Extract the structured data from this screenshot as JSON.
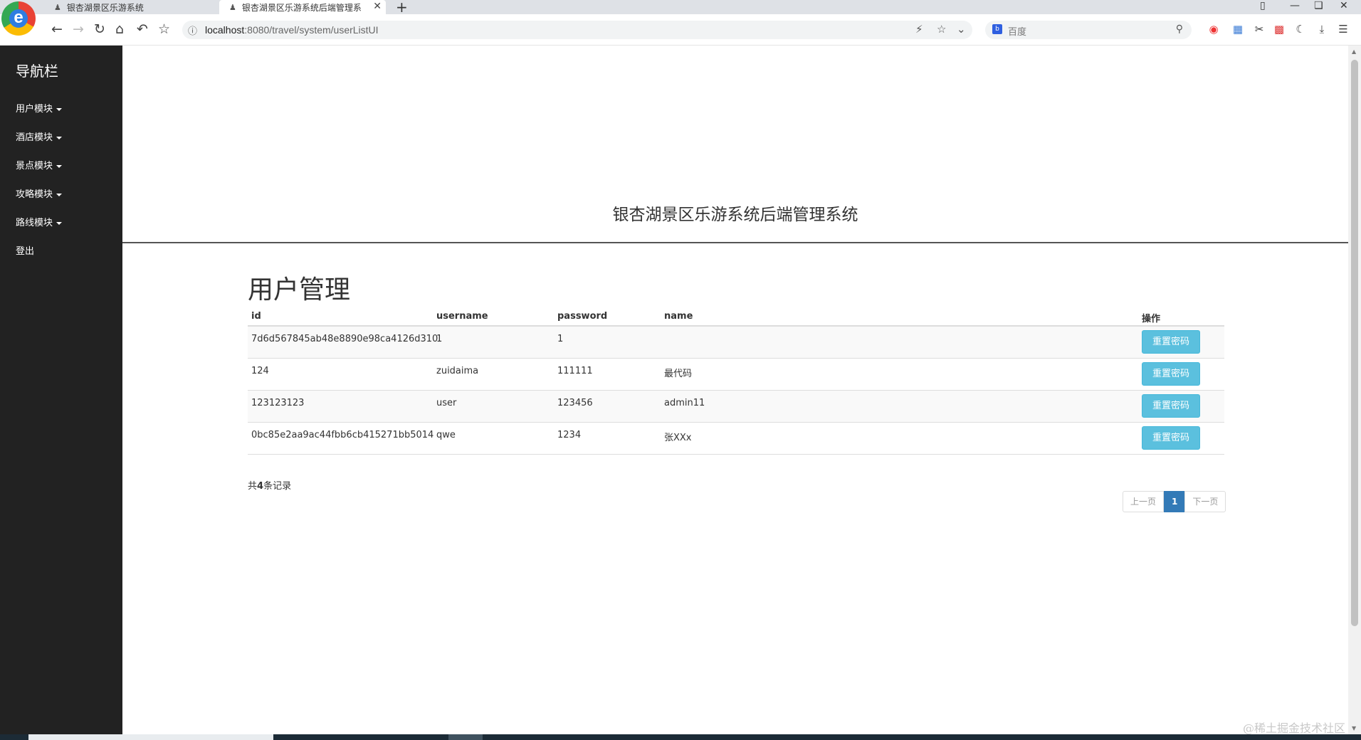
{
  "browser": {
    "tabs": [
      {
        "title": "银杏湖景区乐游系统",
        "active": false
      },
      {
        "title": "银杏湖景区乐游系统后端管理系",
        "active": true
      }
    ],
    "address": {
      "host": "localhost",
      "path": ":8080/travel/system/userListUI"
    },
    "search_placeholder": "百度",
    "logo_letter": "e"
  },
  "sidebar": {
    "brand": "导航栏",
    "items": [
      {
        "label": "用户模块",
        "dropdown": true
      },
      {
        "label": "酒店模块",
        "dropdown": true
      },
      {
        "label": "景点模块",
        "dropdown": true
      },
      {
        "label": "攻略模块",
        "dropdown": true
      },
      {
        "label": "路线模块",
        "dropdown": true
      },
      {
        "label": "登出",
        "dropdown": false
      }
    ]
  },
  "header": {
    "system_title": "银杏湖景区乐游系统后端管理系统"
  },
  "main": {
    "heading": "用户管理",
    "columns": [
      "id",
      "username",
      "password",
      "name",
      "操作"
    ],
    "rows": [
      {
        "id": "7d6d567845ab48e8890e98ca4126d310",
        "username": "1",
        "password": "1",
        "name": "",
        "action": "重置密码"
      },
      {
        "id": "124",
        "username": "zuidaima",
        "password": "111111",
        "name": "最代码",
        "action": "重置密码"
      },
      {
        "id": "123123123",
        "username": "user",
        "password": "123456",
        "name": "admin11",
        "action": "重置密码"
      },
      {
        "id": "0bc85e2aa9ac44fbb6cb415271bb5014",
        "username": "qwe",
        "password": "1234",
        "name": "张XXx",
        "action": "重置密码"
      }
    ],
    "record_count": {
      "prefix": "共",
      "count": "4",
      "suffix": "条记录"
    },
    "pagination": {
      "prev": "上一页",
      "current": "1",
      "next": "下一页"
    }
  },
  "watermark": "@稀土掘金技术社区",
  "colors": {
    "sidebar_bg": "#222222",
    "button_info": "#5bc0de",
    "page_active": "#337ab7"
  }
}
